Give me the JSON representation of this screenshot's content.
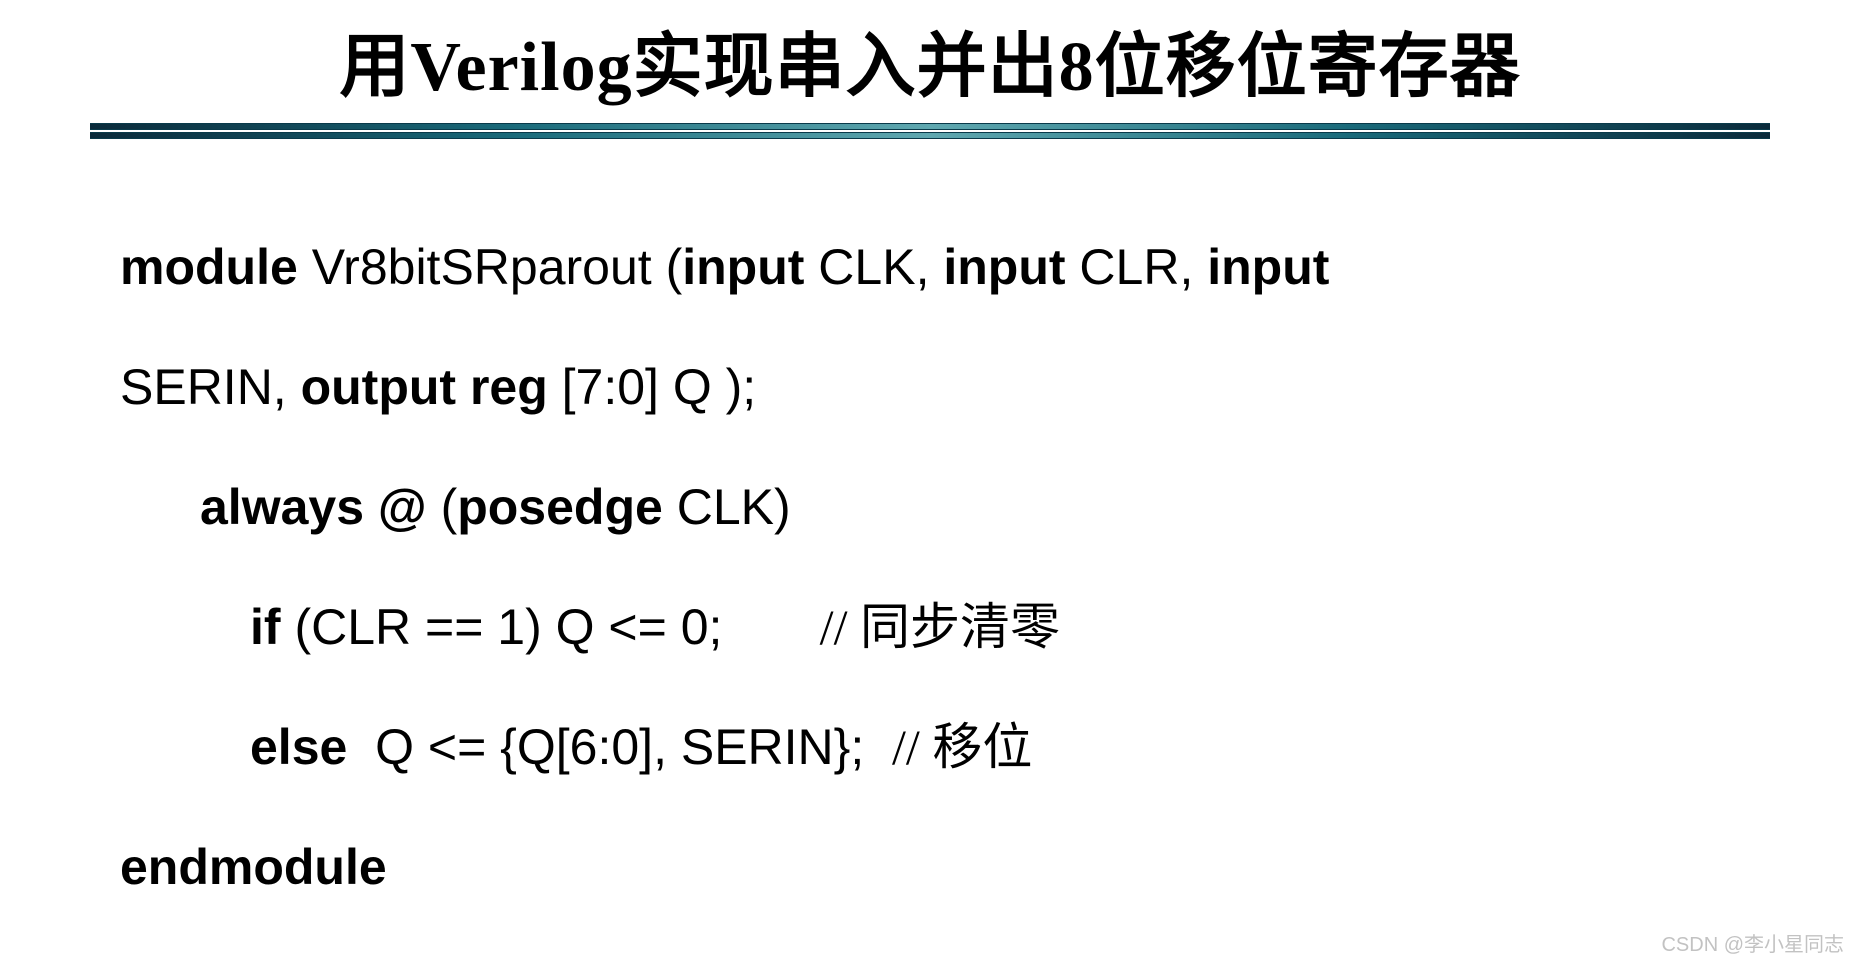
{
  "title": "用Verilog实现串入并出8位移位寄存器",
  "code": {
    "l1_kw1": "module",
    "l1_id": " Vr8bitSRparout (",
    "l1_kw2": "input",
    "l1_t2": " CLK, ",
    "l1_kw3": "input",
    "l1_t3": " CLR, ",
    "l1_kw4": "input",
    "l2_t1": "SERIN, ",
    "l2_kw1": "output reg",
    "l2_t2": " [7:0] Q );",
    "l3_kw1": "always @",
    "l3_t1": " (",
    "l3_kw2": "posedge",
    "l3_t2": " CLK)",
    "l4_kw1": "if",
    "l4_t1": " (CLR == 1) Q <= 0;       ",
    "l4_comment": "// 同步清零",
    "l5_kw1": "else",
    "l5_t1": "  Q <= {Q[6:0], SERIN};  ",
    "l5_comment": "// 移位",
    "l6_kw1": "endmodule"
  },
  "watermark": "CSDN @李小星同志"
}
